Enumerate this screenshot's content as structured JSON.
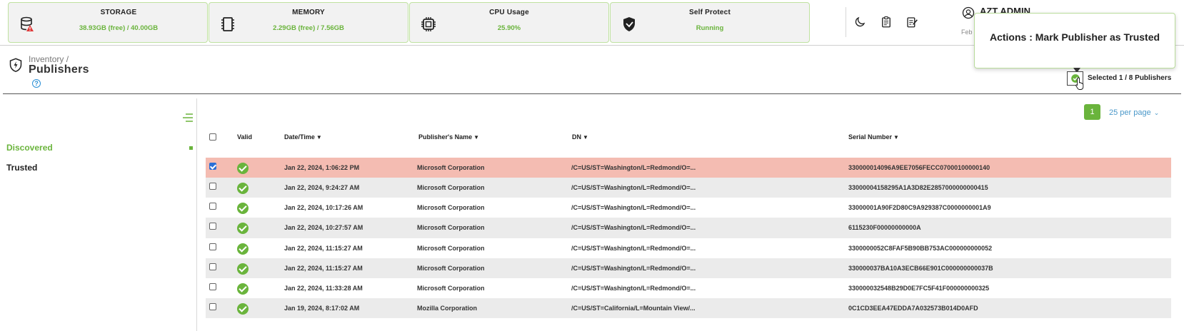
{
  "status_cards": [
    {
      "title": "STORAGE",
      "value": "38.93GB (free) / 40.00GB",
      "icon": "storage-warning-icon"
    },
    {
      "title": "MEMORY",
      "value": "2.29GB (free) / 7.56GB",
      "icon": "memory-chip-icon"
    },
    {
      "title": "CPU Usage",
      "value": "25.90%",
      "icon": "cpu-icon"
    },
    {
      "title": "Self Protect",
      "value": "Running",
      "icon": "shield-icon"
    }
  ],
  "user": {
    "name": "AZT ADMIN",
    "date_prefix": "Feb"
  },
  "tooltip": {
    "text": "Actions : Mark Publisher as Trusted"
  },
  "page": {
    "breadcrumb": "Inventory /",
    "title": "Publishers",
    "help": "?"
  },
  "selection": {
    "text": "Selected 1 / 8 Publishers"
  },
  "sidebar": {
    "items": [
      {
        "label": "Discovered"
      },
      {
        "label": "Trusted"
      }
    ]
  },
  "pagination": {
    "page": "1",
    "per_page": "25 per page"
  },
  "table": {
    "headers": {
      "valid": "Valid",
      "date": "Date/Time",
      "publisher": "Publisher's Name",
      "dn": "DN",
      "serial": "Serial Number"
    },
    "rows": [
      {
        "date": "Jan 22, 2024, 1:06:22 PM",
        "publisher": "Microsoft Corporation",
        "dn": "/C=US/ST=Washington/L=Redmond/O=...",
        "serial": "330000014096A9EE7056FECC07000100000140",
        "selected": true
      },
      {
        "date": "Jan 22, 2024, 9:24:27 AM",
        "publisher": "Microsoft Corporation",
        "dn": "/C=US/ST=Washington/L=Redmond/O=...",
        "serial": "33000004158295A1A3D82E2857000000000415",
        "selected": false
      },
      {
        "date": "Jan 22, 2024, 10:17:26 AM",
        "publisher": "Microsoft Corporation",
        "dn": "/C=US/ST=Washington/L=Redmond/O=...",
        "serial": "33000001A90F2D80C9A929387C0000000001A9",
        "selected": false
      },
      {
        "date": "Jan 22, 2024, 10:27:57 AM",
        "publisher": "Microsoft Corporation",
        "dn": "/C=US/ST=Washington/L=Redmond/O=...",
        "serial": "6115230F00000000000A",
        "selected": false
      },
      {
        "date": "Jan 22, 2024, 11:15:27 AM",
        "publisher": "Microsoft Corporation",
        "dn": "/C=US/ST=Washington/L=Redmond/O=...",
        "serial": "3300000052C8FAF5B90BB753AC000000000052",
        "selected": false
      },
      {
        "date": "Jan 22, 2024, 11:15:27 AM",
        "publisher": "Microsoft Corporation",
        "dn": "/C=US/ST=Washington/L=Redmond/O=...",
        "serial": "330000037BA10A3ECB66E901C000000000037B",
        "selected": false
      },
      {
        "date": "Jan 22, 2024, 11:33:28 AM",
        "publisher": "Microsoft Corporation",
        "dn": "/C=US/ST=Washington/L=Redmond/O=...",
        "serial": "330000032548B29D0E7FC5F41F000000000325",
        "selected": false
      },
      {
        "date": "Jan 19, 2024, 8:17:02 AM",
        "publisher": "Mozilla Corporation",
        "dn": "/C=US/ST=California/L=Mountain View/...",
        "serial": "0C1CD3EEA47EDDA7A032573B014D0AFD",
        "selected": false
      }
    ]
  },
  "colors": {
    "accent": "#6ab43c",
    "selected_row": "#f4bcb2",
    "link": "#4a98c9"
  }
}
